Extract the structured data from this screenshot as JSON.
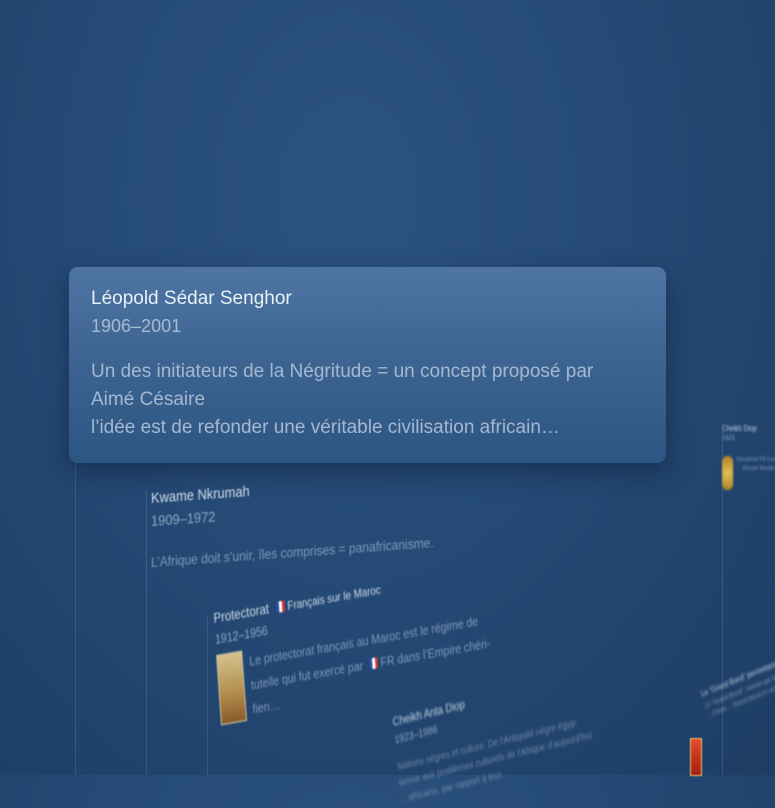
{
  "focused": {
    "name": "Léopold Sédar Senghor",
    "dates": "1906–2001",
    "desc_lines": [
      "Un des initiateurs de la Négritude = un concept proposé par",
      "Aimé Césaire",
      "l’idée est de refonder une véritable civilisation africain…"
    ]
  },
  "nkrumah": {
    "name": "Kwame Nkrumah",
    "dates": "1909–1972",
    "text": "L’Afrique doit s’unir, îles comprises = panafricanisme."
  },
  "protectorat": {
    "name": "Protectorat",
    "tag": "Français sur le Maroc",
    "dates": "1912–1956",
    "line1": "Le protectorat français au Maroc est le régime de",
    "line2a": "tutelle qui fut exercé par",
    "line2b": "FR dans l’Empire chéri-",
    "line3": "fien…"
  },
  "diop": {
    "name": "Cheikh Anta Diop",
    "dates": "1923–1986",
    "line1": "Nations nègres et culture. De l’Antiquité nègre égyp-",
    "line2": "tienne aux problèmes culturels de l’Afrique d’aujourd’hui",
    "line3": "…africains, par rapport à leur…"
  },
  "right_card": {
    "name": "Cheikh Diop",
    "dates": "1923",
    "text1": "Deuxième FR Congrès Mondial",
    "text2": "… Africain Monde"
  },
  "mao_card": {
    "title": "Le “Grand Bond” permettant au pays de dépasser…",
    "text1": "Le “Grand Bond”, menée par Mao…",
    "text2": "…Chine… Grand Bond en avant…"
  }
}
